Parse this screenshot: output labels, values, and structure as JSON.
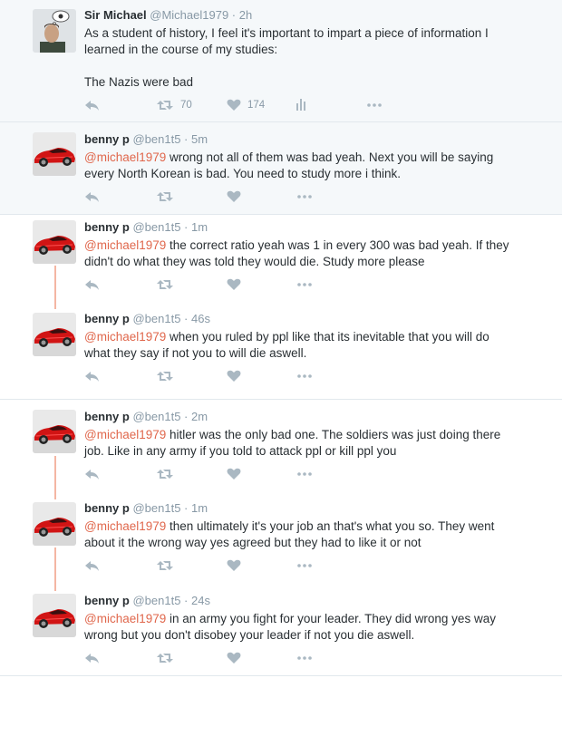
{
  "tweets": [
    {
      "name": "Sir Michael",
      "handle": "@Michael1979",
      "time": "2h",
      "text1": "As a student of history, I feel it's important to impart a piece of information I",
      "text2": "learned in the course of my studies:",
      "text3": "The Nazis were bad",
      "retweets": "70",
      "likes": "174",
      "avatar": "person-thinking-avatar"
    },
    {
      "name": "benny p",
      "handle": "@ben1t5",
      "time": "5m",
      "mention": "@michael1979",
      "text1": " wrong not all of them was bad yeah. Next you will be saying",
      "text2": "every North Korean is bad. You need to study more i think.",
      "avatar": "red-sports-car-avatar"
    },
    {
      "name": "benny p",
      "handle": "@ben1t5",
      "time": "1m",
      "mention": "@michael1979",
      "text1": " the correct ratio yeah was 1 in every 300 was bad yeah. If they",
      "text2": "didn't do what they was told they would die. Study more please",
      "avatar": "red-sports-car-avatar"
    },
    {
      "name": "benny p",
      "handle": "@ben1t5",
      "time": "46s",
      "mention": "@michael1979",
      "text1": " when you ruled by ppl like that its inevitable that you will do",
      "text2": "what they say if not you to will die aswell.",
      "avatar": "red-sports-car-avatar"
    },
    {
      "name": "benny p",
      "handle": "@ben1t5",
      "time": "2m",
      "mention": "@michael1979",
      "text1": " hitler was the only bad one. The soldiers was just doing there",
      "text2": "job. Like in any army if you told to attack ppl or kill ppl you",
      "avatar": "red-sports-car-avatar"
    },
    {
      "name": "benny p",
      "handle": "@ben1t5",
      "time": "1m",
      "mention": "@michael1979",
      "text1": " then ultimately it's your job an that's what you so. They went",
      "text2": "about it the wrong way yes agreed but they had to like it or not",
      "avatar": "red-sports-car-avatar"
    },
    {
      "name": "benny p",
      "handle": "@ben1t5",
      "time": "24s",
      "mention": "@michael1979",
      "text1": " in an army you fight for your leader. They did wrong yes way",
      "text2": "wrong but you don't disobey your leader if not you die aswell.",
      "avatar": "red-sports-car-avatar"
    }
  ],
  "separator": " · ",
  "colors": {
    "mention": "#e0674c",
    "meta": "#8899a6",
    "action": "#aab8c2",
    "thread": "#f4b6a3"
  }
}
